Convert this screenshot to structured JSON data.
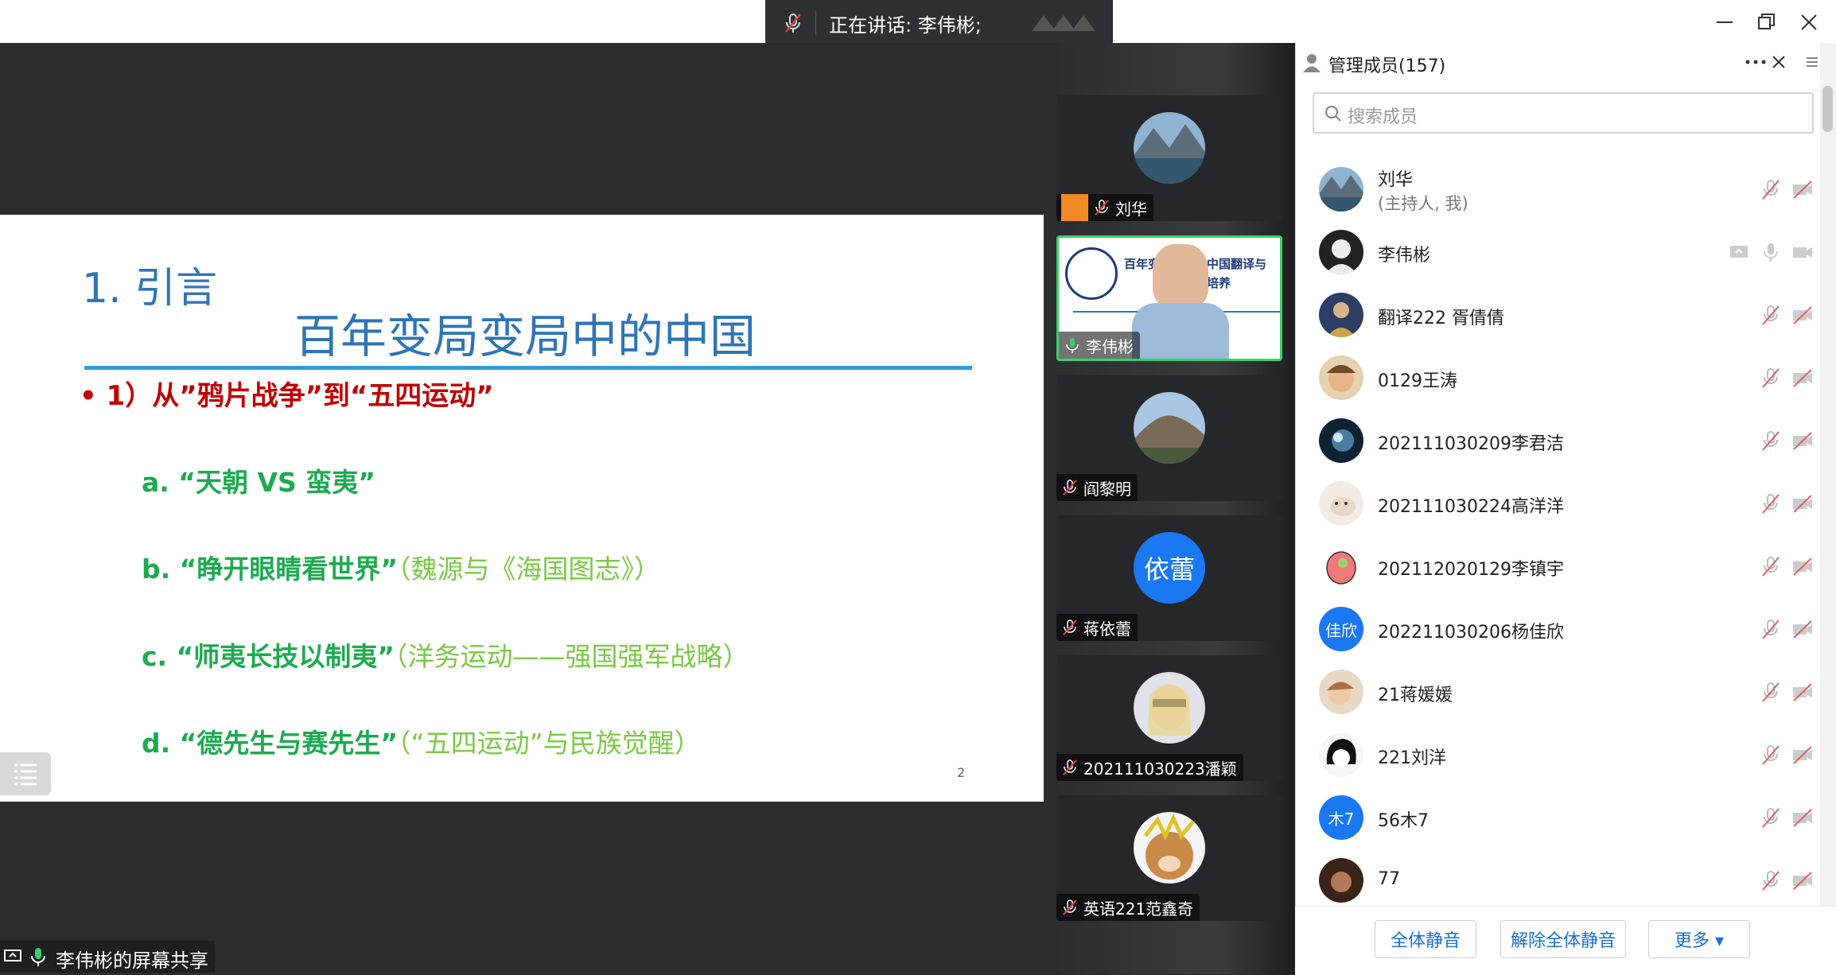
{
  "speaking": {
    "label": "正在讲话: 李伟彬;"
  },
  "slide": {
    "num": "1. 引言",
    "title": "百年变局变局中的中国",
    "bullet": "• 1）从”鸦片战争”到“五四运动”",
    "items": [
      {
        "main": "a. “天朝 VS 蛮夷”",
        "paren": ""
      },
      {
        "main": "b. “睁开眼睛看世界”",
        "paren": "（魏源与《海国图志》）"
      },
      {
        "main": "c. “师夷长技以制夷”",
        "paren": "（洋务运动——强国强军战略）"
      },
      {
        "main": "d. “德先生与赛先生”",
        "paren": "（“五四运动”与民族觉醒）"
      }
    ],
    "page": "2"
  },
  "share_label": "李伟彬的屏幕共享",
  "video_tiles": [
    {
      "name": "刘华"
    },
    {
      "name": "李伟彬",
      "screen_text_1": "百年变",
      "screen_text_2": "中国翻译与",
      "screen_text_3": "培养"
    },
    {
      "name": "阎黎明"
    },
    {
      "name": "蒋依蕾",
      "avatar_text": "依蕾"
    },
    {
      "name": "202111030223潘颖"
    },
    {
      "name": "英语221范鑫奇"
    }
  ],
  "panel": {
    "title": "管理成员(157)",
    "search_placeholder": "搜索成员",
    "members": [
      {
        "name": "刘华",
        "sub": "(主持人, 我)"
      },
      {
        "name": "李伟彬"
      },
      {
        "name": "翻译222 胥倩倩"
      },
      {
        "name": "0129王涛"
      },
      {
        "name": "202111030209李君洁"
      },
      {
        "name": "202111030224高洋洋"
      },
      {
        "name": "202112020129李镇宇"
      },
      {
        "name": "202211030206杨佳欣",
        "avatar_text": "佳欣"
      },
      {
        "name": "21蒋媛媛"
      },
      {
        "name": "221刘洋"
      },
      {
        "name": "56木7",
        "avatar_text": "木7"
      },
      {
        "name": "77"
      }
    ],
    "buttons": {
      "mute_all": "全体静音",
      "unmute_all": "解除全体静音",
      "more": "更多 ▾"
    }
  },
  "colors": {
    "accent": "#1a78f2",
    "active_border": "#3ad06a",
    "slide_blue": "#2e75b6",
    "bullet_red": "#c00000",
    "item_green": "#1daa50"
  }
}
